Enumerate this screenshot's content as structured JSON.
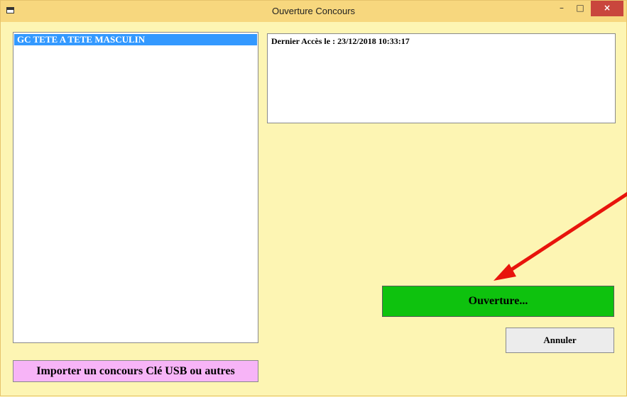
{
  "window": {
    "title": "Ouverture Concours",
    "controls": {
      "minimize": "–",
      "maximize": "□",
      "close": "×"
    }
  },
  "contest_list": {
    "items": [
      {
        "label": "GC TETE A TETE MASCULIN",
        "selected": true
      }
    ]
  },
  "info": {
    "last_access": "Dernier Accès le : 23/12/2018 10:33:17"
  },
  "buttons": {
    "open": "Ouverture...",
    "cancel": "Annuler",
    "import": "Importer un concours Clé USB ou autres"
  },
  "colors": {
    "background": "#fdf5b3",
    "titlebar": "#f7d77e",
    "open_button": "#0ec20e",
    "import_button": "#f7b4f7",
    "selection": "#3399ff",
    "annotation_arrow": "#e8140c"
  },
  "icons": {
    "app": "app-window-icon",
    "annotation": "red-arrow-annotation"
  }
}
